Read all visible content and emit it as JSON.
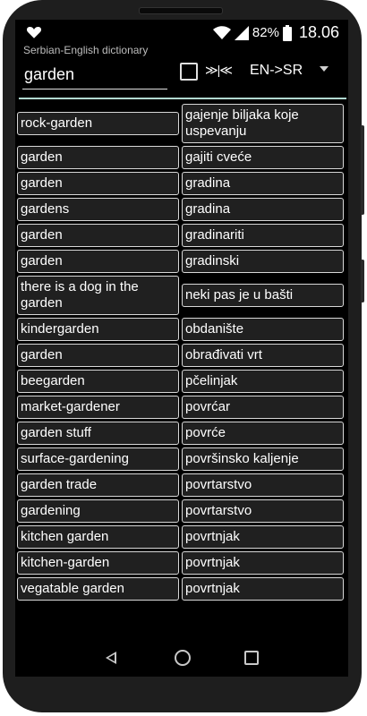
{
  "status_bar": {
    "battery_percent": "82%",
    "time": "18.06"
  },
  "app": {
    "title": "Serbian-English dictionary"
  },
  "search": {
    "value": "garden"
  },
  "controls": {
    "swap_label": "≫|≪",
    "direction": "EN->SR"
  },
  "rows": [
    {
      "en": "rock-garden",
      "sr": "gajenje biljaka koje uspevanju"
    },
    {
      "en": "garden",
      "sr": "gajiti cveće"
    },
    {
      "en": "garden",
      "sr": "gradina"
    },
    {
      "en": "gardens",
      "sr": "gradina"
    },
    {
      "en": "garden",
      "sr": "gradinariti"
    },
    {
      "en": "garden",
      "sr": "gradinski"
    },
    {
      "en": "there is a dog in the garden",
      "sr": "neki pas je u bašti"
    },
    {
      "en": "kindergarden",
      "sr": "obdanište"
    },
    {
      "en": "garden",
      "sr": "obrađivati vrt"
    },
    {
      "en": "beegarden",
      "sr": "pčelinjak"
    },
    {
      "en": "market-gardener",
      "sr": "povrćar"
    },
    {
      "en": "garden stuff",
      "sr": "povrće"
    },
    {
      "en": "surface-gardening",
      "sr": "površinsko kaljenje"
    },
    {
      "en": "garden trade",
      "sr": "povrtarstvo"
    },
    {
      "en": "gardening",
      "sr": "povrtarstvo"
    },
    {
      "en": "kitchen garden",
      "sr": "povrtnjak"
    },
    {
      "en": "kitchen-garden",
      "sr": "povrtnjak"
    },
    {
      "en": "vegatable garden",
      "sr": "povrtnjak"
    }
  ],
  "icons": {
    "status": [
      "heart-icon",
      "wifi-icon",
      "signal-icon",
      "battery-icon"
    ],
    "nav": [
      "back-icon",
      "home-icon",
      "recents-icon"
    ]
  },
  "colors": {
    "accent_line": "#b0d8d0",
    "cell_bg": "#202020",
    "cell_border": "#d8d8d8"
  }
}
